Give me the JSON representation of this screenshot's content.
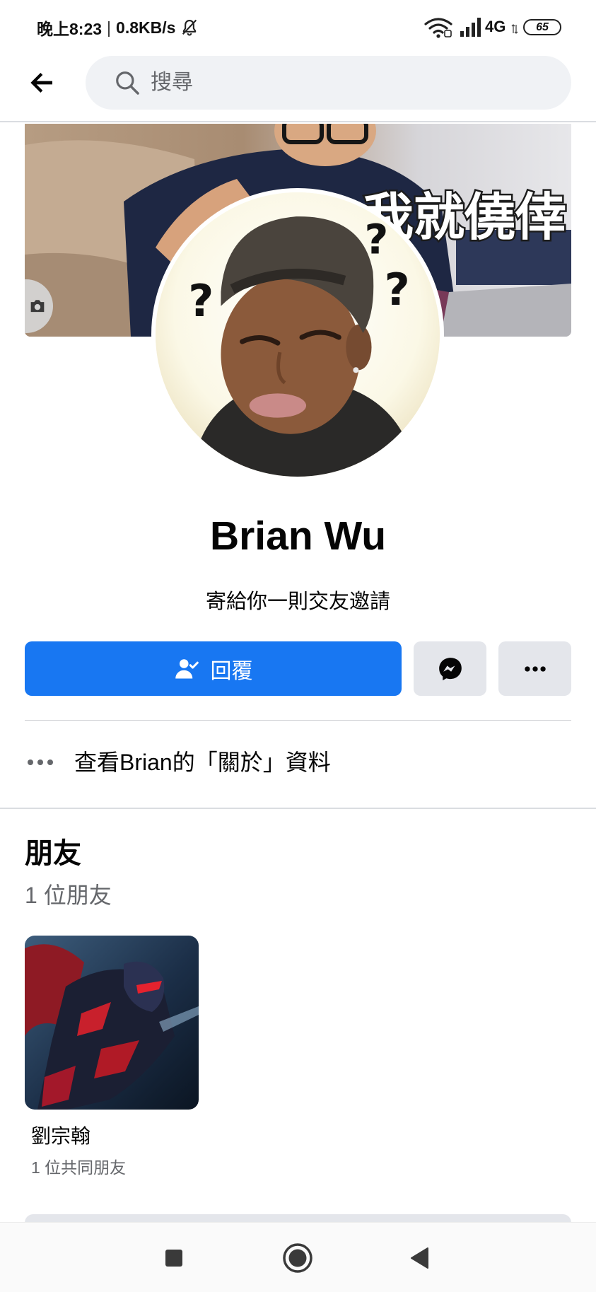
{
  "status_bar": {
    "time": "晚上8:23",
    "separator": "|",
    "speed": "0.8KB/s",
    "network": "4G",
    "battery": "65",
    "icons": [
      "bell-off-icon",
      "wifi-icon",
      "signal-icon",
      "data-arrows-icon",
      "battery-icon"
    ]
  },
  "header": {
    "search_placeholder": "搜尋",
    "icons": {
      "back": "back-arrow-icon",
      "search": "search-icon"
    }
  },
  "cover": {
    "caption": "我就僥倖",
    "icons": {
      "edit": "camera-icon"
    }
  },
  "profile": {
    "avatar_marks": [
      "?",
      "?",
      "?"
    ],
    "name": "Brian Wu",
    "subtitle": "寄給你一則交友邀請"
  },
  "actions": {
    "respond_label": "回覆",
    "icons": {
      "respond": "person-check-icon",
      "message": "messenger-icon",
      "more": "more-dots-icon"
    }
  },
  "about": {
    "label": "查看Brian的「關於」資料",
    "icon": "more-dots-icon"
  },
  "friends": {
    "heading": "朋友",
    "count": "1 位朋友",
    "items": [
      {
        "name": "劉宗翰",
        "mutual": "1 位共同朋友"
      }
    ]
  },
  "nav_bar": {
    "icons": [
      "recents-square-icon",
      "home-circle-icon",
      "back-triangle-icon"
    ]
  },
  "colors": {
    "primary": "#1877F2",
    "secondary_button": "#E4E6EB",
    "search_background": "#F0F2F5",
    "text": "#050505",
    "muted_text": "#65676B",
    "divider": "#CED0D4"
  }
}
